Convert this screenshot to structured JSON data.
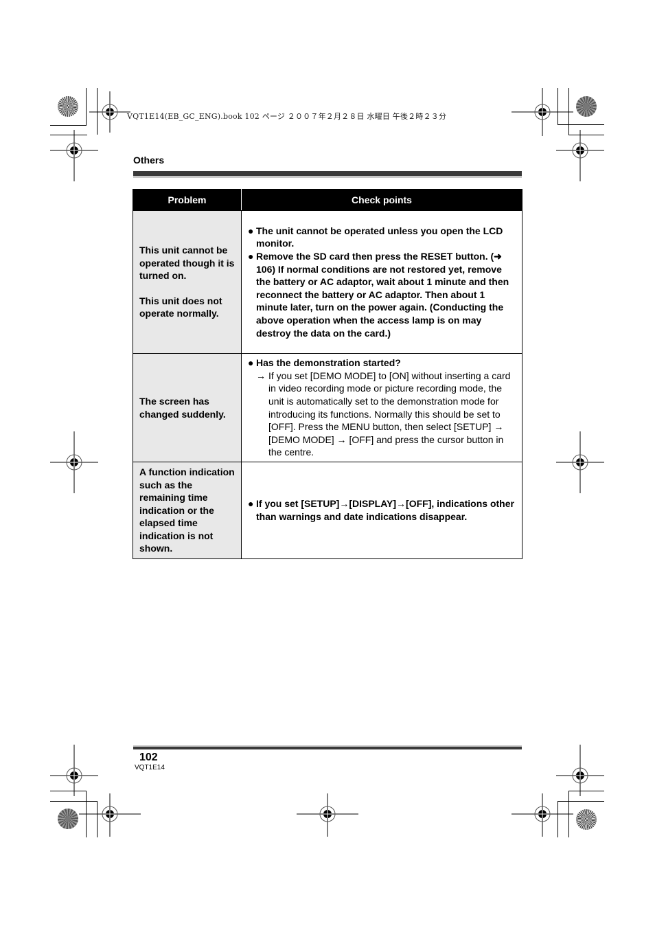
{
  "print_slug": "VQT1E14(EB_GC_ENG).book  102 ページ  ２００７年２月２８日  水曜日  午後２時２３分",
  "header": {
    "section": "Others"
  },
  "table": {
    "columns": [
      "Problem",
      "Check points"
    ],
    "rows": [
      {
        "problem": [
          "This unit cannot be operated though it is turned on.",
          "This unit does not operate normally."
        ],
        "checks": [
          {
            "bullet": "●",
            "text": "The unit cannot be operated unless you open the LCD monitor.",
            "bold": true
          },
          {
            "bullet": "●",
            "text": "Remove the SD card then press the RESET button. (➜ 106) If normal conditions are not restored yet, remove the battery or AC adaptor, wait about 1 minute and then reconnect the battery or AC adaptor. Then about 1 minute later, turn on the power again. (Conducting the above operation when the access lamp is on may destroy the data on the card.)",
            "bold": true
          }
        ]
      },
      {
        "problem": [
          "The screen has changed suddenly."
        ],
        "checks": [
          {
            "bullet": "●",
            "text": "Has the demonstration started?",
            "bold": true,
            "sub": {
              "arrow": "→",
              "text": "If you set [DEMO MODE] to [ON] without inserting a card in video recording mode or picture recording mode, the unit is automatically set to the demonstration mode for introducing its functions. Normally this should be set to [OFF]. Press the MENU button, then select [SETUP] → [DEMO MODE] → [OFF] and press the cursor button in the centre."
            }
          }
        ]
      },
      {
        "problem": [
          "A function indication such as the remaining time indication or the elapsed time indication is not shown."
        ],
        "checks": [
          {
            "bullet": "●",
            "text": "If you set [SETUP]→[DISPLAY]→[OFF], indications other than warnings and date indications disappear.",
            "bold": true
          }
        ]
      }
    ]
  },
  "footer": {
    "page_number": "102",
    "model_code": "VQT1E14"
  }
}
